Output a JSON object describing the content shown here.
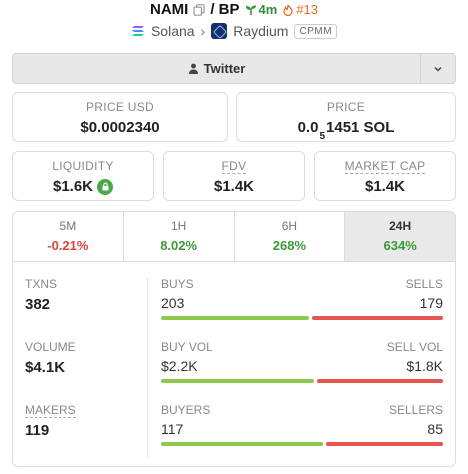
{
  "header": {
    "token": "NAMI",
    "quote": "/ BP",
    "age": "4m",
    "rank": "#13",
    "chain": "Solana",
    "dex": "Raydium",
    "pool_type": "CPMM"
  },
  "twitter": {
    "label": "Twitter"
  },
  "price": {
    "usd_label": "PRICE USD",
    "usd_value": "$0.0002340",
    "native_label": "PRICE",
    "native_prefix": "0.0",
    "native_sub": "5",
    "native_rest": "1451 SOL"
  },
  "metrics": {
    "liquidity_label": "LIQUIDITY",
    "liquidity_value": "$1.6K",
    "fdv_label": "FDV",
    "fdv_value": "$1.4K",
    "mcap_label": "MARKET CAP",
    "mcap_value": "$1.4K"
  },
  "tabs": [
    {
      "label": "5M",
      "value": "-0.21%"
    },
    {
      "label": "1H",
      "value": "8.02%"
    },
    {
      "label": "6H",
      "value": "268%"
    },
    {
      "label": "24H",
      "value": "634%"
    }
  ],
  "stats": {
    "txns_label": "TXNS",
    "txns_value": "382",
    "buys_label": "BUYS",
    "buys_value": "203",
    "sells_label": "SELLS",
    "sells_value": "179",
    "volume_label": "VOLUME",
    "volume_value": "$4.1K",
    "buyvol_label": "BUY VOL",
    "buyvol_value": "$2.2K",
    "sellvol_label": "SELL VOL",
    "sellvol_value": "$1.8K",
    "makers_label": "MAKERS",
    "makers_value": "119",
    "buyers_label": "BUYERS",
    "buyers_value": "117",
    "sellers_label": "SELLERS",
    "sellers_value": "85"
  },
  "bars": {
    "buys_fraction": 0.53,
    "buyvol_fraction": 0.55,
    "buyers_fraction": 0.58
  },
  "colors": {
    "positive": "#3c9a34",
    "negative": "#d9433f",
    "buy_bar": "#8cc84b",
    "sell_bar": "#e5564f"
  }
}
